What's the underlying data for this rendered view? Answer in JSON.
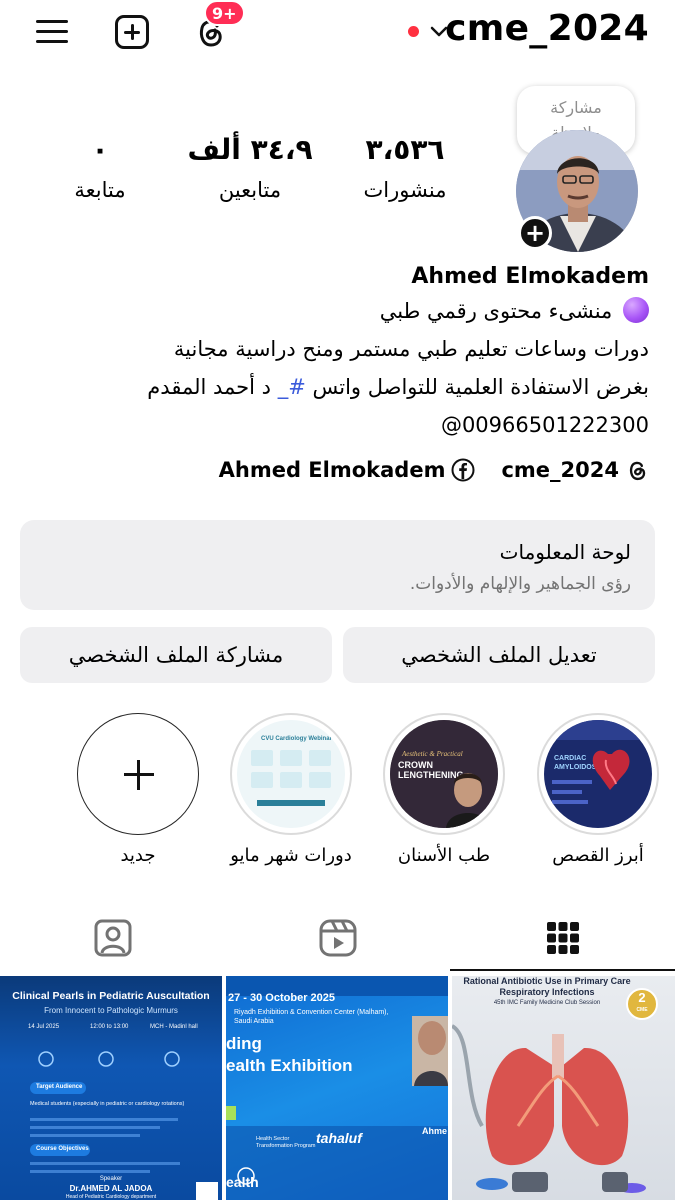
{
  "header": {
    "username": "cme_2024",
    "notification_badge": "9+",
    "menu_icon": "hamburger-menu-icon",
    "create_icon": "create-post-icon",
    "threads_icon": "threads-icon",
    "dropdown_icon": "chevron-down-icon",
    "accent_color": "#ff3040"
  },
  "note": {
    "line1": "مشاركة",
    "line2": "ملاحظة"
  },
  "stats": {
    "posts": {
      "value": "٣،٥٣٦",
      "label": "منشورات"
    },
    "followers": {
      "value": "٣٤،٩ ألف",
      "label": "متابعين"
    },
    "following": {
      "value": "٠",
      "label": "متابعة"
    }
  },
  "bio": {
    "name": "Ahmed Elmokadem",
    "category": "منشىء محتوى رقمي طبي",
    "line1": "دورات وساعات تعليم طبي  مستمر  ومنح دراسية مجانية",
    "line2_a": "بغرض الاستفادة العلمية  للتواصل  واتس ",
    "line2_hash": "#_",
    "line2_b": " د  أحمد المقدم",
    "line3": "@00966501222300"
  },
  "links": {
    "threads": "cme_2024",
    "facebook": "Ahmed Elmokadem"
  },
  "dashboard": {
    "title": "لوحة المعلومات",
    "subtitle": "رؤى الجماهير والإلهام والأدوات."
  },
  "buttons": {
    "edit_profile": "تعديل الملف الشخصي",
    "share_profile": "مشاركة الملف الشخصي"
  },
  "highlights": [
    {
      "label": "أبرز القصص",
      "image_text": "CARDIAC AMYLOIDOSIS"
    },
    {
      "label": "طب الأسنان",
      "image_text": "CROWN LENGTHENING"
    },
    {
      "label": "دورات شهر مايو",
      "image_text": "CVU Cardiology Webinar"
    },
    {
      "label": "جديد"
    }
  ],
  "tabs": [
    "posts-grid-icon",
    "reels-icon",
    "tagged-icon"
  ],
  "posts": [
    {
      "title": "Clinical Pearls in Pediatric Auscultation",
      "subtitle": "From Innocent to Pathologic Murmurs",
      "date": "14 Jul 2025",
      "time": "12:00 to 13:00",
      "place": "MCH - Madinl hall",
      "section1": "Target Audience",
      "audience": "Medical students (especially in pediatric or cardiology rotations)",
      "section2": "Course Objectives",
      "section3": "Speaker",
      "speaker": "Dr.AHMED AL JADOA",
      "speaker_role": "Head of Pediatric Cardiology department"
    },
    {
      "dates": "27 - 30 October 2025",
      "venue": "Riyadh Exhibition & Convention Center (Malham), Saudi Arabia",
      "headline1": "ding",
      "headline2": "ealth Exhibition",
      "program": "Health Sector Transformation Program",
      "brand": "tahaluf",
      "footer": "ealth",
      "speaker": "Ahme"
    },
    {
      "title": "Rational Antibiotic Use in Primary Care Respiratory Infections",
      "subtitle": "45th IMC Family Medicine Club Session",
      "badge_num": "2",
      "badge_txt": "CME"
    }
  ]
}
